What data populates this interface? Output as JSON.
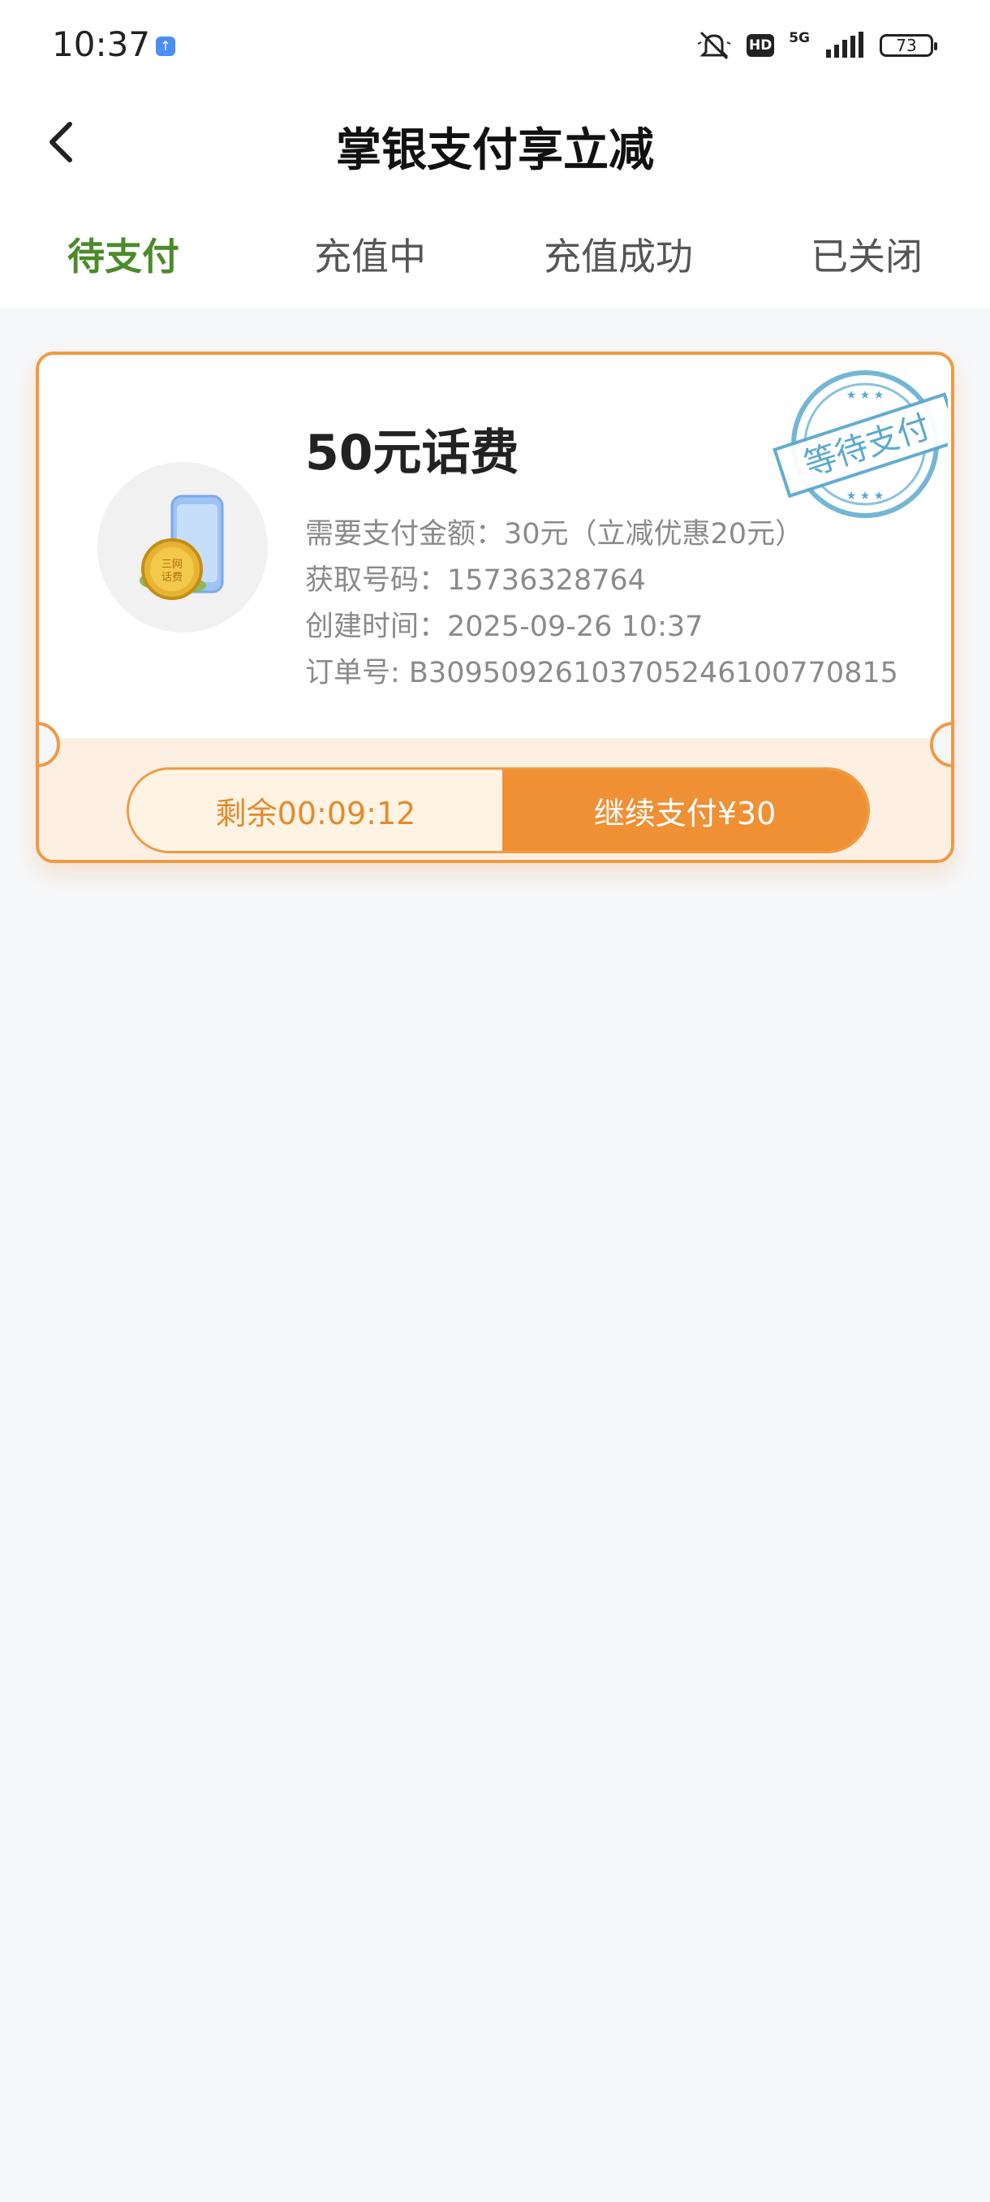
{
  "status_bar": {
    "time": "10:37",
    "network": "5G",
    "hd": "HD",
    "battery": "73"
  },
  "header": {
    "title": "掌银支付享立减",
    "back_icon": "chevron-left-icon"
  },
  "tabs": [
    {
      "label": "待支付",
      "active": true
    },
    {
      "label": "充值中",
      "active": false
    },
    {
      "label": "充值成功",
      "active": false
    },
    {
      "label": "已关闭",
      "active": false
    }
  ],
  "order": {
    "product_title": "50元话费",
    "image_badge": "三网话费",
    "stamp_text": "等待支付",
    "amount_line": "需要支付金额：30元（立减优惠20元）",
    "phone_line": "获取号码：15736328764",
    "time_line": "创建时间：2025-09-26 10:37",
    "order_no_line": "订单号: B30950926103705246100770815",
    "countdown": "剩余00:09:12",
    "pay_button": "继续支付¥30"
  },
  "colors": {
    "accent": "#ef9035",
    "active_tab": "#4b8b2a",
    "stamp": "#5aa9cf"
  }
}
